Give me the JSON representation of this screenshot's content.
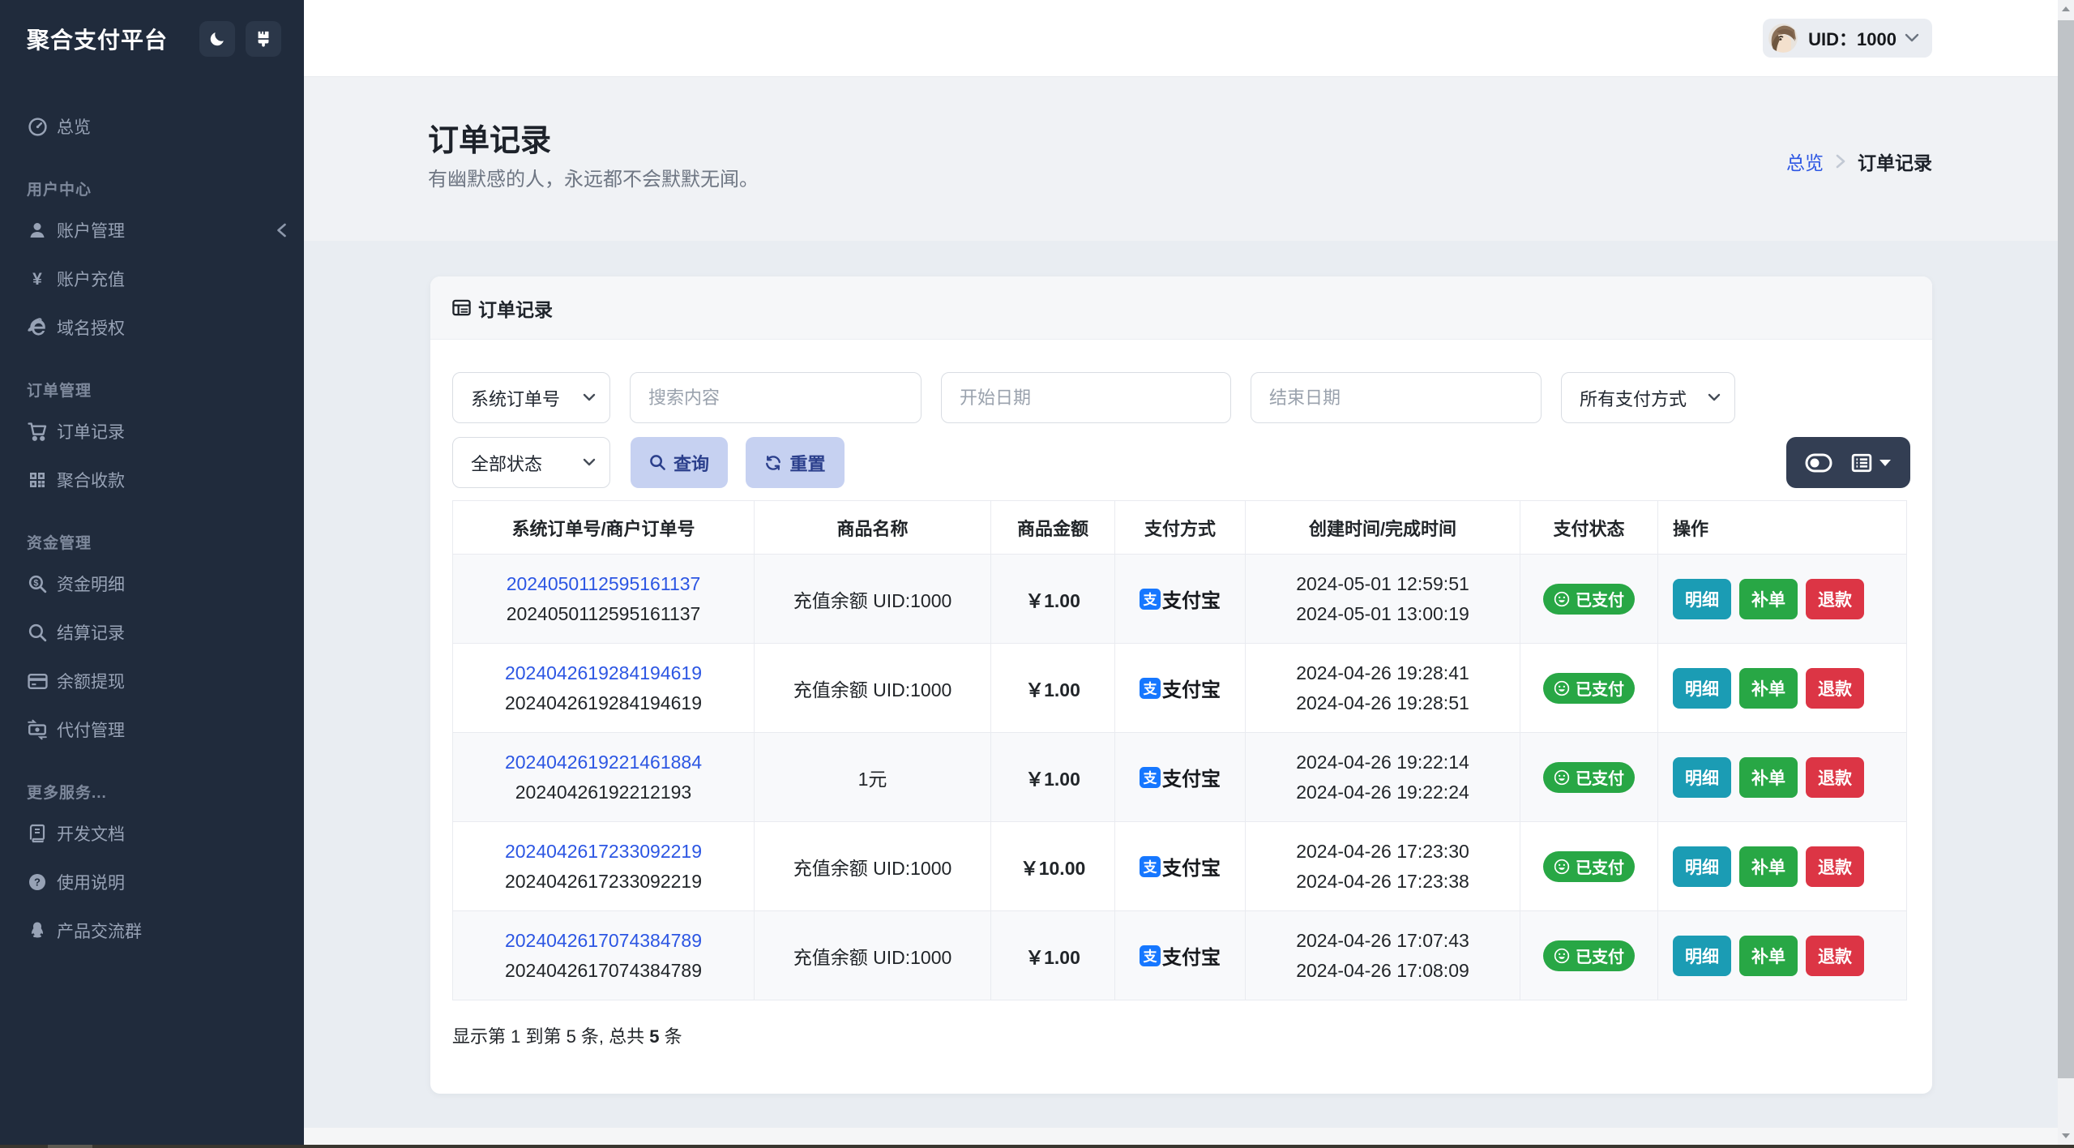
{
  "colors": {
    "sidebar_bg": "#202b3c",
    "primary_blue": "#2c56e3",
    "soft_button_bg": "#c6d1f1",
    "soft_button_text": "#2b3f8c",
    "badge_paid_green": "#28a745",
    "btn_detail_teal": "#1b9cb4",
    "btn_supplement_green": "#28a745",
    "btn_refund_red": "#dc3545",
    "alipay_blue": "#1677ff",
    "toolbar_dark": "#333e53"
  },
  "sidebar": {
    "brand": "聚合支付平台",
    "theme_buttons": [
      {
        "name": "dark-mode-button",
        "icon": "moon-icon"
      },
      {
        "name": "theme-skin-button",
        "icon": "brush-icon"
      }
    ],
    "sections": [
      {
        "label": "",
        "items": [
          {
            "icon": "gauge-icon",
            "label": "总览"
          }
        ]
      },
      {
        "label": "用户中心",
        "items": [
          {
            "icon": "user-icon",
            "label": "账户管理",
            "collapse": true
          },
          {
            "icon": "yen-icon",
            "label": "账户充值"
          },
          {
            "icon": "globe-e-icon",
            "label": "域名授权"
          }
        ]
      },
      {
        "label": "订单管理",
        "items": [
          {
            "icon": "cart-icon",
            "label": "订单记录"
          },
          {
            "icon": "qrcode-icon",
            "label": "聚合收款"
          }
        ]
      },
      {
        "label": "资金管理",
        "items": [
          {
            "icon": "search-dollar-icon",
            "label": "资金明细"
          },
          {
            "icon": "search-icon",
            "label": "结算记录"
          },
          {
            "icon": "credit-card-icon",
            "label": "余额提现"
          },
          {
            "icon": "money-transfer-icon",
            "label": "代付管理"
          }
        ]
      },
      {
        "label": "更多服务...",
        "items": [
          {
            "icon": "book-icon",
            "label": "开发文档"
          },
          {
            "icon": "question-circle-icon",
            "label": "使用说明"
          },
          {
            "icon": "qq-penguin-icon",
            "label": "产品交流群"
          }
        ]
      }
    ]
  },
  "topbar": {
    "user_label": "UID：1000"
  },
  "banner": {
    "title": "订单记录",
    "subtitle": "有幽默感的人，永远都不会默默无闻。",
    "breadcrumb": {
      "home": "总览",
      "current": "订单记录"
    }
  },
  "card": {
    "title": "订单记录",
    "filters": {
      "order_type_value": "系统订单号",
      "search_placeholder": "搜索内容",
      "start_date_placeholder": "开始日期",
      "end_date_placeholder": "结束日期",
      "pay_type_value": "所有支付方式",
      "status_value": "全部状态",
      "query_label": "查询",
      "reset_label": "重置"
    },
    "table": {
      "columns": [
        "系统订单号/商户订单号",
        "商品名称",
        "商品金额",
        "支付方式",
        "创建时间/完成时间",
        "支付状态",
        "操作"
      ],
      "action_labels": [
        "明细",
        "补单",
        "退款"
      ],
      "rows": [
        {
          "sys_no": "2024050112595161137",
          "merchant_no": "2024050112595161137",
          "product": "充值余额 UID:1000",
          "amount": "￥1.00",
          "pay_method": "支付宝",
          "created": "2024-05-01 12:59:51",
          "completed": "2024-05-01 13:00:19",
          "status": "已支付"
        },
        {
          "sys_no": "2024042619284194619",
          "merchant_no": "2024042619284194619",
          "product": "充值余额 UID:1000",
          "amount": "￥1.00",
          "pay_method": "支付宝",
          "created": "2024-04-26 19:28:41",
          "completed": "2024-04-26 19:28:51",
          "status": "已支付"
        },
        {
          "sys_no": "2024042619221461884",
          "merchant_no": "20240426192212193",
          "product": "1元",
          "amount": "￥1.00",
          "pay_method": "支付宝",
          "created": "2024-04-26 19:22:14",
          "completed": "2024-04-26 19:22:24",
          "status": "已支付"
        },
        {
          "sys_no": "2024042617233092219",
          "merchant_no": "2024042617233092219",
          "product": "充值余额 UID:1000",
          "amount": "￥10.00",
          "pay_method": "支付宝",
          "created": "2024-04-26 17:23:30",
          "completed": "2024-04-26 17:23:38",
          "status": "已支付"
        },
        {
          "sys_no": "2024042617074384789",
          "merchant_no": "2024042617074384789",
          "product": "充值余额 UID:1000",
          "amount": "￥1.00",
          "pay_method": "支付宝",
          "created": "2024-04-26 17:07:43",
          "completed": "2024-04-26 17:08:09",
          "status": "已支付"
        }
      ],
      "footer": {
        "prefix": "显示第 1 到第 5 条, 总共 ",
        "total": "5",
        "suffix": " 条"
      }
    }
  }
}
